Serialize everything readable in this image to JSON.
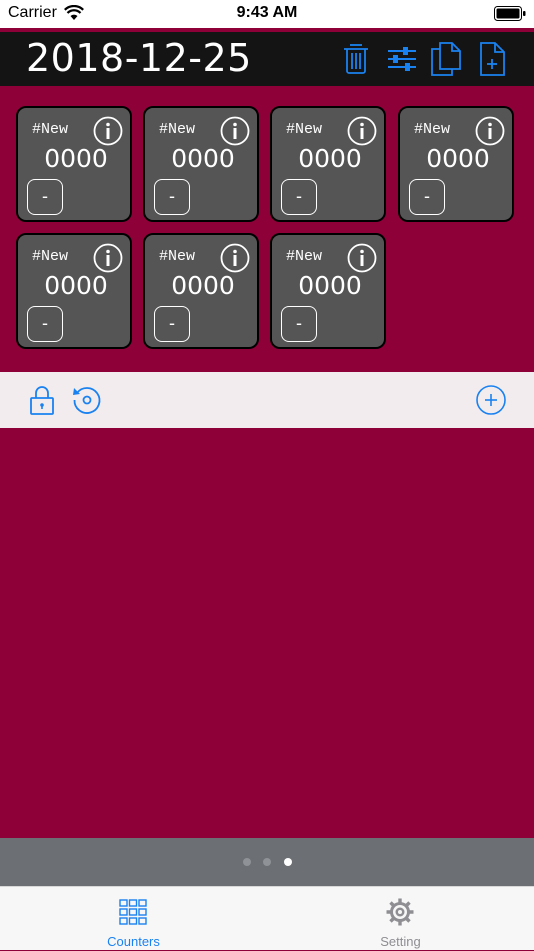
{
  "status_bar": {
    "carrier": "Carrier",
    "time": "9:43 AM"
  },
  "header": {
    "date": "2018-12-25",
    "icons": [
      "trash-icon",
      "sliders-icon",
      "copy-icon",
      "new-document-icon"
    ]
  },
  "counters": [
    {
      "tag": "#New",
      "value": "0000",
      "minus_label": "-"
    },
    {
      "tag": "#New",
      "value": "0000",
      "minus_label": "-"
    },
    {
      "tag": "#New",
      "value": "0000",
      "minus_label": "-"
    },
    {
      "tag": "#New",
      "value": "0000",
      "minus_label": "-"
    },
    {
      "tag": "#New",
      "value": "0000",
      "minus_label": "-"
    },
    {
      "tag": "#New",
      "value": "0000",
      "minus_label": "-"
    },
    {
      "tag": "#New",
      "value": "0000",
      "minus_label": "-"
    }
  ],
  "toolbar": {
    "icons": [
      "lock-icon",
      "reset-icon",
      "add-circle-icon"
    ]
  },
  "page_indicator": {
    "count": 3,
    "current": 3
  },
  "tabs": [
    {
      "label": "Counters",
      "icon": "grid-icon",
      "active": true
    },
    {
      "label": "Setting",
      "icon": "gear-icon",
      "active": false
    }
  ],
  "colors": {
    "background": "#8e0038",
    "header": "#141414",
    "tile": "#555555",
    "accent": "#1a82f0",
    "toolbar": "#f2ecef",
    "page_bar": "#6c6f73",
    "inactive_tab": "#8e8e93"
  }
}
